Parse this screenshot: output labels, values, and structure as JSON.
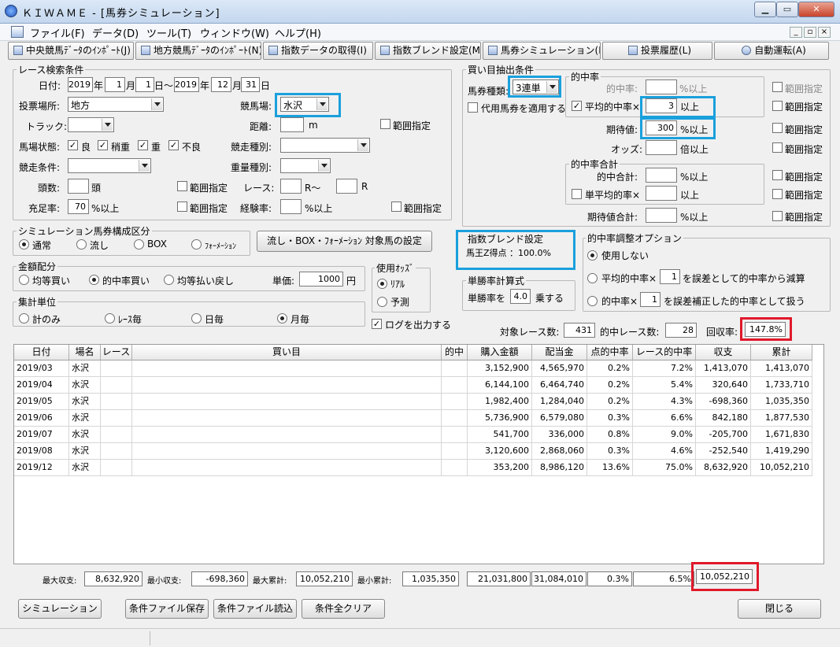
{
  "window": {
    "title": "ＫＩＷＡＭＥ - [馬券シミュレーション]",
    "min": "▁",
    "max": "▭",
    "close": "✕"
  },
  "menu": [
    "ファイル(F)",
    "データ(D)",
    "ツール(T)",
    "ウィンドウ(W)",
    "ヘルプ(H)"
  ],
  "mdi": {
    "min": "_",
    "max": "▫",
    "close": "×"
  },
  "toolbar": [
    "中央競馬ﾃﾞｰﾀのｲﾝﾎﾟｰﾄ(J)",
    "地方競馬ﾃﾞｰﾀのｲﾝﾎﾟｰﾄ(N)",
    "指数データの取得(I)",
    "指数ブレンド設定(M)",
    "馬券シミュレーション(B)",
    "投票履歴(L)",
    "自動運転(A)"
  ],
  "race": {
    "title": "レース検索条件",
    "date_label": "日付:",
    "y1": "2019",
    "m1": "1",
    "d1": "1",
    "y2": "2019",
    "m2": "12",
    "d2": "31",
    "u_year": "年",
    "u_month": "月",
    "u_day_from": "日〜",
    "u_day": "日",
    "place_label": "投票場所:",
    "place": "地方",
    "track_name_label": "競馬場:",
    "track_name": "水沢",
    "track_label": "トラック:",
    "dist_label": "距離:",
    "dist_unit": "m",
    "range": "範囲指定",
    "cond_label": "馬場状態:",
    "conds": [
      "良",
      "稍重",
      "重",
      "不良"
    ],
    "race_type_label": "競走種別:",
    "race_cond_label": "競走条件:",
    "weight_label": "重量種別:",
    "heads_label": "頭数:",
    "heads_unit": "頭",
    "race_no_label": "レース:",
    "race_from_unit": "R〜",
    "race_to_unit": "R",
    "fill_label": "充足率:",
    "fill": "70",
    "fill_unit": "%以上",
    "exp_label": "経験率:",
    "exp_unit": "%以上"
  },
  "buy": {
    "title": "買い目抽出条件",
    "kind_label": "馬券種類:",
    "kind": "3連単",
    "substitute": "代用馬券を適用する",
    "hit_title": "的中率",
    "hit_label": "的中率:",
    "hit_unit": "%以上",
    "avg_label": "平均的中率×",
    "avg": "3",
    "avg_unit": "以上",
    "exp_label": "期待値:",
    "exp": "300",
    "exp_unit": "%以上",
    "odds_label": "オッズ:",
    "odds_unit": "倍以上",
    "range": "範囲指定",
    "sum_title": "的中率合計",
    "sum_hit_label": "的中合計:",
    "sum_hit_unit": "%以上",
    "single_label": "単平均的率×",
    "single_unit": "以上",
    "exp_sum_label": "期待値合計:",
    "exp_sum_unit": "%以上"
  },
  "sim": {
    "title": "シミュレーション馬券構成区分",
    "options": [
      "通常",
      "流し",
      "BOX",
      "ﾌｫｰﾒｰｼｮﾝ"
    ],
    "target_button": "流し・BOX・ﾌｫｰﾒｰｼｮﾝ 対象馬の設定"
  },
  "blend": {
    "title": "指数ブレンド設定",
    "value": "馬王Z得点 ：100.0%"
  },
  "adjust": {
    "title": "的中率調整オプション",
    "opt1": "使用しない",
    "opt2a": "平均的中率×",
    "opt2v": "1",
    "opt2b": "を誤差として的中率から減算",
    "opt3a": "的中率×",
    "opt3v": "1",
    "opt3b": "を誤差補正した的中率として扱う"
  },
  "money": {
    "title": "金額配分",
    "options": [
      "均等買い",
      "的中率買い",
      "均等払い戻し"
    ],
    "unit_price_label": "単価:",
    "unit_price": "1000",
    "unit_price_unit": "円"
  },
  "odds": {
    "title": "使用ｵｯｽﾞ",
    "options": [
      "ﾘｱﾙ",
      "予測"
    ]
  },
  "win_calc": {
    "title": "単勝率計算式",
    "label": "単勝率を",
    "value": "4.0",
    "unit": "乗する"
  },
  "agg": {
    "title": "集計単位",
    "options": [
      "計のみ",
      "ﾚｰｽ毎",
      "日毎",
      "月毎"
    ]
  },
  "log_label": "ログを出力する",
  "stats": {
    "target_label": "対象レース数:",
    "target": "431",
    "hit_label": "的中レース数:",
    "hit": "28",
    "recovery_label": "回収率:",
    "recovery": "147.8%"
  },
  "table": {
    "headers": [
      "日付",
      "場名",
      "レース",
      "買い目",
      "的中",
      "購入金額",
      "配当金",
      "点的中率",
      "レース的中率",
      "収支",
      "累計"
    ],
    "rows": [
      [
        "2019/03",
        "水沢",
        "",
        "",
        "",
        "3,152,900",
        "4,565,970",
        "0.2%",
        "7.2%",
        "1,413,070",
        "1,413,070"
      ],
      [
        "2019/04",
        "水沢",
        "",
        "",
        "",
        "6,144,100",
        "6,464,740",
        "0.2%",
        "5.4%",
        "320,640",
        "1,733,710"
      ],
      [
        "2019/05",
        "水沢",
        "",
        "",
        "",
        "1,982,400",
        "1,284,040",
        "0.2%",
        "4.3%",
        "-698,360",
        "1,035,350"
      ],
      [
        "2019/06",
        "水沢",
        "",
        "",
        "",
        "5,736,900",
        "6,579,080",
        "0.3%",
        "6.6%",
        "842,180",
        "1,877,530"
      ],
      [
        "2019/07",
        "水沢",
        "",
        "",
        "",
        "541,700",
        "336,000",
        "0.8%",
        "9.0%",
        "-205,700",
        "1,671,830"
      ],
      [
        "2019/08",
        "水沢",
        "",
        "",
        "",
        "3,120,600",
        "2,868,060",
        "0.3%",
        "4.6%",
        "-252,540",
        "1,419,290"
      ],
      [
        "2019/12",
        "水沢",
        "",
        "",
        "",
        "353,200",
        "8,986,120",
        "13.6%",
        "75.0%",
        "8,632,920",
        "10,052,210"
      ]
    ]
  },
  "summary": {
    "max_label": "最大収支:",
    "max": "8,632,920",
    "min_label": "最小収支:",
    "min": "-698,360",
    "max_cum_label": "最大累計:",
    "max_cum": "10,052,210",
    "min_cum_label": "最小累計:",
    "min_cum": "1,035,350",
    "buy_total": "21,031,800",
    "pay_total": "31,084,010",
    "pt_rate": "0.3%",
    "race_rate": "6.5%",
    "total": "10,052,210"
  },
  "buttons": {
    "simulate": "シミュレーション",
    "save": "条件ファイル保存",
    "load": "条件ファイル読込",
    "clear": "条件全クリア",
    "close": "閉じる"
  }
}
